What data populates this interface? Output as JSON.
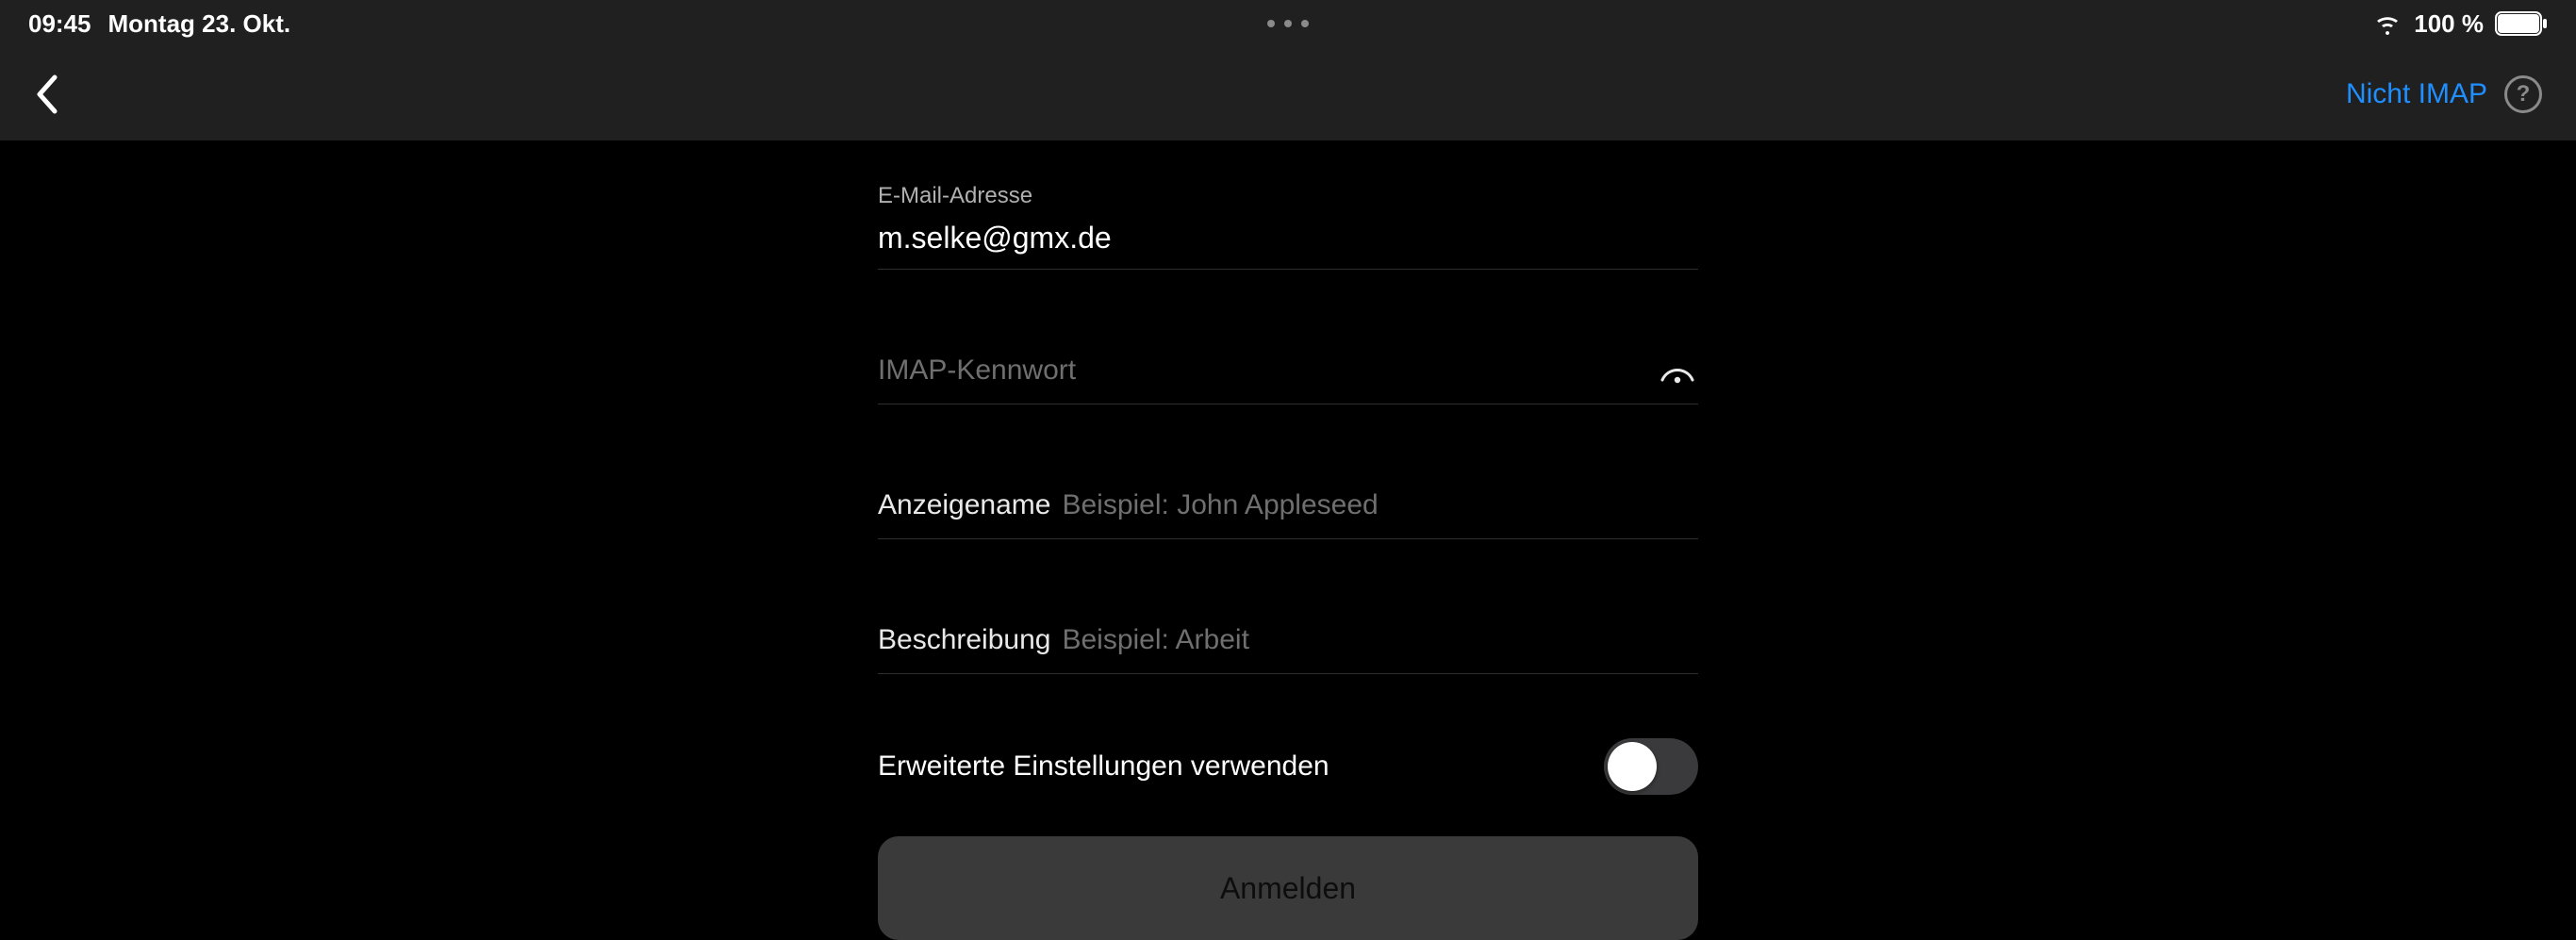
{
  "status": {
    "time": "09:45",
    "date": "Montag 23. Okt.",
    "battery_pct": "100 %"
  },
  "nav": {
    "not_imap": "Nicht IMAP",
    "help": "?"
  },
  "form": {
    "email_label": "E-Mail-Adresse",
    "email_value": "m.selke@gmx.de",
    "password_placeholder": "IMAP-Kennwort",
    "display_name_label": "Anzeigename",
    "display_name_placeholder": "Beispiel: John Appleseed",
    "description_label": "Beschreibung",
    "description_placeholder": "Beispiel: Arbeit",
    "advanced_label": "Erweiterte Einstellungen verwenden",
    "advanced_enabled": false,
    "signin_label": "Anmelden"
  }
}
